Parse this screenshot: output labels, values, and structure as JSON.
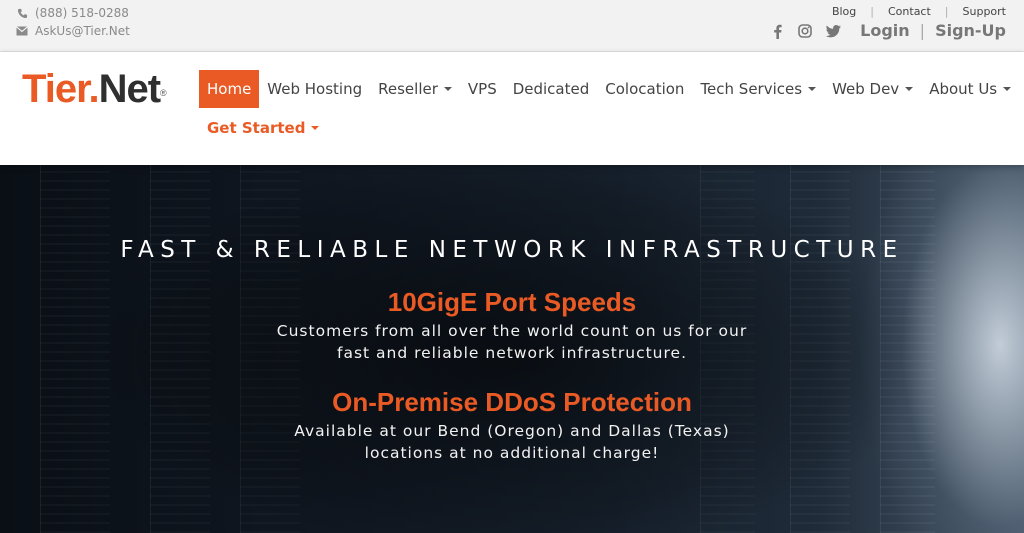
{
  "topbar": {
    "phone": "(888) 518-0288",
    "email": "AskUs@Tier.Net",
    "links": [
      "Blog",
      "Contact",
      "Support"
    ],
    "social_icons": [
      "facebook-icon",
      "instagram-icon",
      "twitter-icon"
    ],
    "login_label": "Login",
    "signup_label": "Sign-Up"
  },
  "logo": {
    "part1": "Tier",
    "dot": ".",
    "part2": "Net",
    "reg": "®"
  },
  "nav": {
    "items": [
      {
        "label": "Home",
        "active": true,
        "dropdown": false
      },
      {
        "label": "Web Hosting",
        "dropdown": false
      },
      {
        "label": "Reseller",
        "dropdown": true
      },
      {
        "label": "VPS",
        "dropdown": false
      },
      {
        "label": "Dedicated",
        "dropdown": false
      },
      {
        "label": "Colocation",
        "dropdown": false
      },
      {
        "label": "Tech Services",
        "dropdown": true
      },
      {
        "label": "Web Dev",
        "dropdown": true
      },
      {
        "label": "About Us",
        "dropdown": true
      }
    ],
    "get_started": "Get Started"
  },
  "hero": {
    "title": "FAST & RELIABLE NETWORK INFRASTRUCTURE",
    "features": [
      {
        "title": "10GigE Port Speeds",
        "line1": "Customers from all over the world count on us for our",
        "line2": "fast and reliable network infrastructure."
      },
      {
        "title": "On-Premise DDoS Protection",
        "line1": "Available at our Bend (Oregon) and Dallas (Texas)",
        "line2": "locations at no additional charge!"
      }
    ]
  },
  "colors": {
    "brand_orange": "#ea5a24",
    "topbar_bg": "#f2f2f2",
    "text_gray": "#444444"
  }
}
